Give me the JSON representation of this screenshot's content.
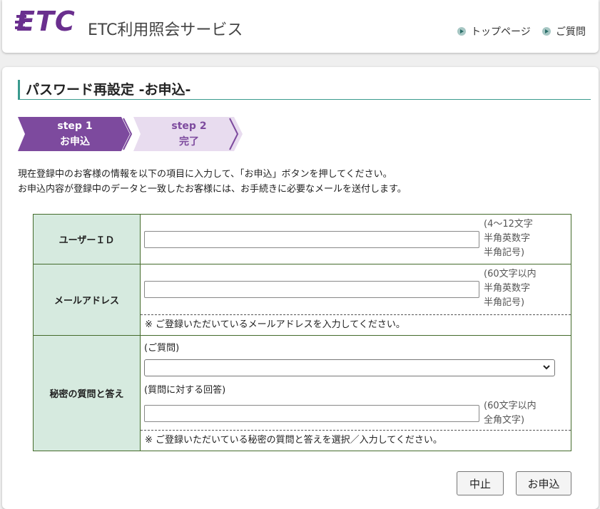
{
  "header": {
    "logo_text": "ETC",
    "service_name": "ETC利用照会サービス",
    "links": [
      {
        "label": "トップページ",
        "icon": "arrow-right-circle-icon"
      },
      {
        "label": "ご質問",
        "icon": "arrow-right-circle-icon"
      }
    ]
  },
  "page": {
    "title": "パスワード再設定 -お申込-"
  },
  "steps": [
    {
      "step": "step 1",
      "label": "お申込",
      "active": true
    },
    {
      "step": "step 2",
      "label": "完了",
      "active": false
    }
  ],
  "intro": [
    "現在登録中のお客様の情報を以下の項目に入力して、「お申込」ボタンを押してください。",
    "お申込内容が登録中のデータと一致したお客様には、お手続きに必要なメールを送付します。"
  ],
  "form": {
    "user_id": {
      "label": "ユーザーＩＤ",
      "value": "",
      "hint": [
        "(4～12文字",
        "半角英数字",
        "半角記号)"
      ]
    },
    "email": {
      "label": "メールアドレス",
      "value": "",
      "hint": [
        "(60文字以内",
        "半角英数字",
        "半角記号)"
      ],
      "note": "※ ご登録いただいているメールアドレスを入力してください。"
    },
    "secret": {
      "label": "秘密の質問と答え",
      "question_label": "(ご質問)",
      "question_selected": "",
      "answer_label": "(質問に対する回答)",
      "answer_value": "",
      "hint": [
        "(60文字以内",
        "全角文字)"
      ],
      "note": "※ ご登録いただいている秘密の質問と答えを選択／入力してください。"
    }
  },
  "buttons": {
    "cancel": "中止",
    "submit": "お申込"
  },
  "colors": {
    "brand": "#6a2f8e",
    "step_active": "#7d4a9e",
    "step_inactive": "#e8dcef",
    "accent": "#3a9a8e",
    "label_bg": "#d6eadf",
    "table_border": "#446b2b"
  }
}
